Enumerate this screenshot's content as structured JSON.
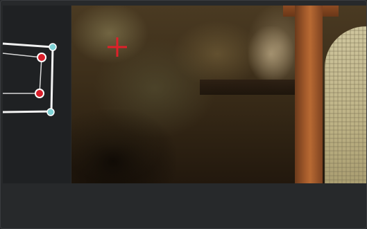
{
  "viewer": {
    "description_icon": "crosshair-icon"
  },
  "colors": {
    "background": "#27292b",
    "panel": "#1f2123",
    "crosshair": "#e0202a",
    "mask_outline": "#f2f2f2",
    "outer_handle": "#7fd3d6",
    "inner_handle": "#d81e2a"
  }
}
